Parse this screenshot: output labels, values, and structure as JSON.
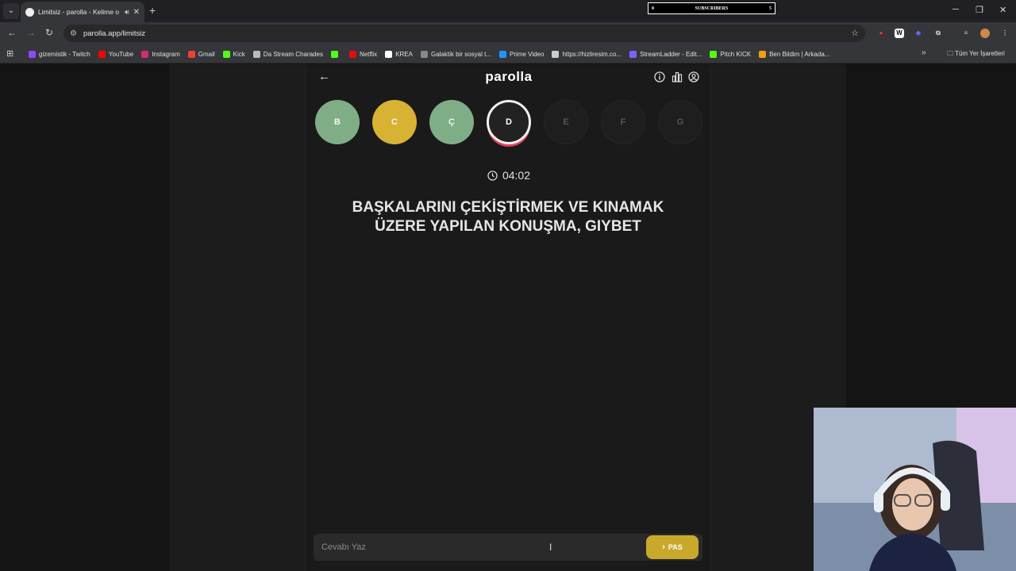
{
  "browser": {
    "tab_title": "Limitsiz - parolla - Kelime o",
    "new_tab": "+",
    "url": "parolla.app/limitsiz",
    "subscribers": {
      "left": "0",
      "label": "SUBSCRIBERS",
      "right": "5"
    }
  },
  "bookmarks": [
    {
      "label": "gizemistik - Twitch",
      "color": "#9147ff"
    },
    {
      "label": "YouTube",
      "color": "#ff0000"
    },
    {
      "label": "Instagram",
      "color": "#d62976"
    },
    {
      "label": "Gmail",
      "color": "#ea4335"
    },
    {
      "label": "Kick",
      "color": "#53fc18"
    },
    {
      "label": "Da Stream Charades",
      "color": "#bbbbbb"
    },
    {
      "label": "",
      "color": "#53fc18"
    },
    {
      "label": "Netflix",
      "color": "#e50914"
    },
    {
      "label": "KREA",
      "color": "#ffffff"
    },
    {
      "label": "Galaktik bir sosyal t...",
      "color": "#888888"
    },
    {
      "label": "Prime Video",
      "color": "#1a98ff"
    },
    {
      "label": "https://hizliresim.co...",
      "color": "#cccccc"
    },
    {
      "label": "StreamLadder - Edit...",
      "color": "#7b61ff"
    },
    {
      "label": "Pitch KICK",
      "color": "#53fc18"
    },
    {
      "label": "Ben Bildim | Arkada...",
      "color": "#f39c12"
    }
  ],
  "bookmarks_all": "Tüm Yer İşaretleri",
  "app": {
    "logo": "parolla",
    "letters": [
      {
        "letter": "B",
        "state": "correct"
      },
      {
        "letter": "C",
        "state": "passed"
      },
      {
        "letter": "Ç",
        "state": "correct"
      },
      {
        "letter": "D",
        "state": "active"
      },
      {
        "letter": "E",
        "state": "pending"
      },
      {
        "letter": "F",
        "state": "pending"
      },
      {
        "letter": "G",
        "state": "pending"
      }
    ],
    "timer": "04:02",
    "question": "BAŞKALARINI ÇEKİŞTİRMEK VE KINAMAK ÜZERE YAPILAN KONUŞMA, GIYBET",
    "answer_placeholder": "Cevabı Yaz",
    "pass_label": "PAS"
  },
  "colors": {
    "correct": "#7fae86",
    "passed": "#d8b233",
    "active": "#222222",
    "pending": "#1e1e1e",
    "accent": "#c9a92c"
  }
}
